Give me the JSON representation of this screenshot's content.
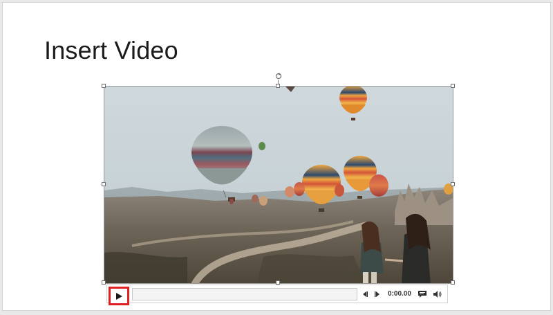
{
  "slide": {
    "title": "Insert Video"
  },
  "video": {
    "content": "hot-air-balloons-over-valley"
  },
  "controls": {
    "play_icon": "play-icon",
    "step_back_icon": "step-back-icon",
    "step_forward_icon": "step-forward-icon",
    "time": "0:00.00",
    "captions_icon": "captions-icon",
    "volume_icon": "volume-icon"
  },
  "colors": {
    "highlight": "#e02020",
    "slide_background": "#ffffff",
    "canvas_background": "#e9e9e9"
  }
}
